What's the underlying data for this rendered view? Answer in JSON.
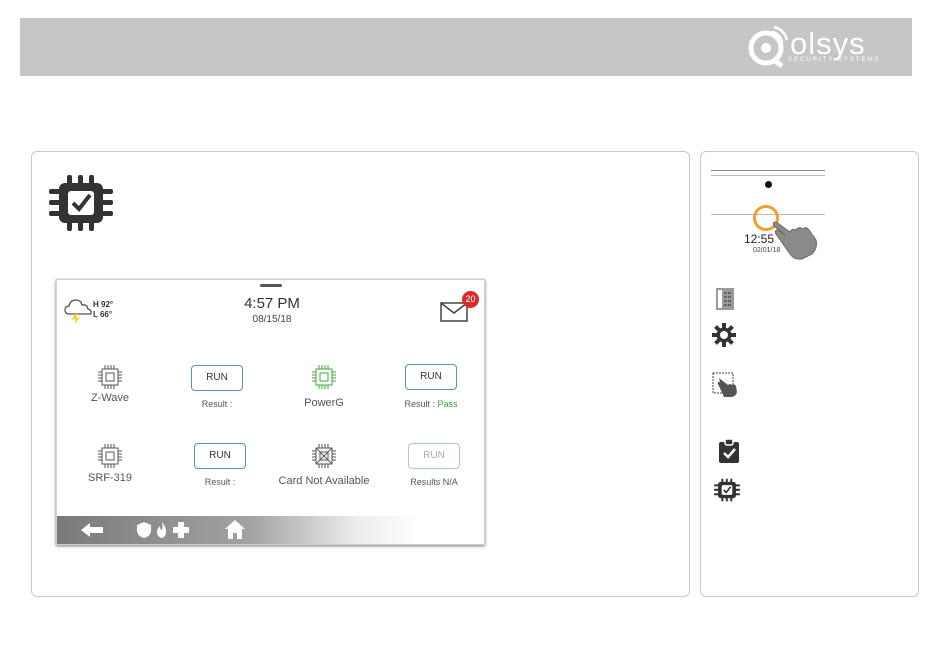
{
  "header": {
    "brand": "olsys",
    "brand_tagline": "SECURITY SYSTEMS"
  },
  "screen": {
    "weather": {
      "icon": "storm-cloud-icon",
      "high": "H 92°",
      "low": "L 66°"
    },
    "time": "4:57 PM",
    "date": "08/15/18",
    "messages_badge": "20",
    "tests": [
      {
        "name": "Z-Wave",
        "button": "RUN",
        "result_label": "Result :",
        "result_value": "",
        "enabled": true
      },
      {
        "name": "PowerG",
        "button": "RUN",
        "result_label": "Result :",
        "result_value": "Pass",
        "enabled": true
      },
      {
        "name": "SRF-319",
        "button": "RUN",
        "result_label": "Result :",
        "result_value": "",
        "enabled": true
      },
      {
        "name": "Card Not Available",
        "button": "RUN",
        "result_label": "Results N/A",
        "result_value": "",
        "enabled": false
      }
    ],
    "taskbar_icons": [
      "back-arrow-icon",
      "shield-icon",
      "fire-icon",
      "medical-cross-icon",
      "home-icon"
    ]
  },
  "side": {
    "clock_time": "12:55",
    "clock_date": "02/01/18",
    "icons": [
      "panel-settings-icon",
      "gear-icon",
      "touch-grid-icon",
      "clipboard-check-icon",
      "chip-check-icon"
    ]
  },
  "colors": {
    "header_bg": "#c6c6c6",
    "accent_orange": "#f0a030",
    "pass_green": "#35a035",
    "badge_red": "#d62b2b",
    "button_border": "#5a8fbf",
    "chip_green": "#3fa83f"
  }
}
